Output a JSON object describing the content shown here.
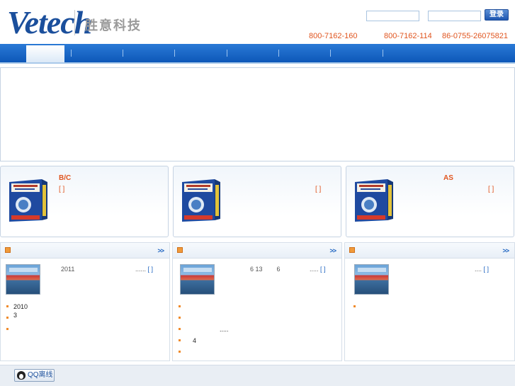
{
  "header": {
    "logo_text": "Vetech",
    "logo_cn": "胜意科技",
    "login_button": "登录",
    "phones": [
      "800-7162-160",
      "800-7162-114",
      "86-0755-26075821"
    ]
  },
  "nav": {
    "item_count": 7
  },
  "products": [
    {
      "title": "B/C",
      "more": "[ ]"
    },
    {
      "title": "",
      "more": "[ ]"
    },
    {
      "title": "AS",
      "more": "[ ]"
    }
  ],
  "news": [
    {
      "more": ">>",
      "headline": "2011",
      "headline_more": "......",
      "link": "[ ]",
      "items": [
        "2010 3",
        "",
        ""
      ]
    },
    {
      "more": ">>",
      "headline": "6 13        6",
      "headline_more": ".....",
      "link": "[ ]",
      "items": [
        "",
        "",
        ".....",
        "4",
        ""
      ]
    },
    {
      "more": ">>",
      "headline": "",
      "headline_more": "....",
      "link": "[ ]",
      "items": [
        ""
      ]
    }
  ],
  "footer": {
    "qq_label": "QQ离线"
  },
  "colors": {
    "brand_blue": "#1b4f9c",
    "accent_orange": "#e0551f",
    "nav_blue": "#1a66c8"
  }
}
